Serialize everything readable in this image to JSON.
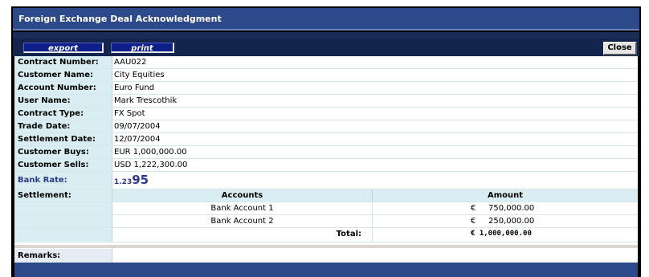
{
  "window": {
    "title": "Foreign Exchange Deal Acknowledgment"
  },
  "toolbar": {
    "export_label": "export",
    "print_label": "print",
    "close_label": "Close"
  },
  "fields": [
    {
      "label": "Contract Number:",
      "value": "AAU022"
    },
    {
      "label": "Customer Name:",
      "value": "City Equities"
    },
    {
      "label": "Account Number:",
      "value": "Euro Fund"
    },
    {
      "label": "User Name:",
      "value": "Mark Trescothik"
    },
    {
      "label": "Contract Type:",
      "value": "FX Spot"
    },
    {
      "label": "Trade Date:",
      "value": "09/07/2004"
    },
    {
      "label": "Settlement Date:",
      "value": "12/07/2004"
    },
    {
      "label": "Customer Buys:",
      "value": "EUR 1,000,000.00"
    },
    {
      "label": "Customer Sells:",
      "value": "USD 1,222,300.00"
    }
  ],
  "bank_rate": {
    "label": "Bank Rate:",
    "value_small": "1.23",
    "value_big": "95"
  },
  "settlement": {
    "label": "Settlement:",
    "headers": {
      "accounts": "Accounts",
      "amount": "Amount"
    },
    "rows": [
      {
        "account": "Bank Account 1",
        "currency": "€",
        "amount": "750,000.00"
      },
      {
        "account": "Bank Account 2",
        "currency": "€",
        "amount": "250,000.00"
      }
    ],
    "total_label": "Total:",
    "total_value": "€ 1,000,000.00"
  },
  "remarks": {
    "label": "Remarks:",
    "value": ""
  },
  "colors": {
    "title_bar": "#2c4a8a",
    "label_bg": "#d8eef3",
    "button_bg": "#0f1f8a",
    "rate_text": "#2c3a8c"
  }
}
